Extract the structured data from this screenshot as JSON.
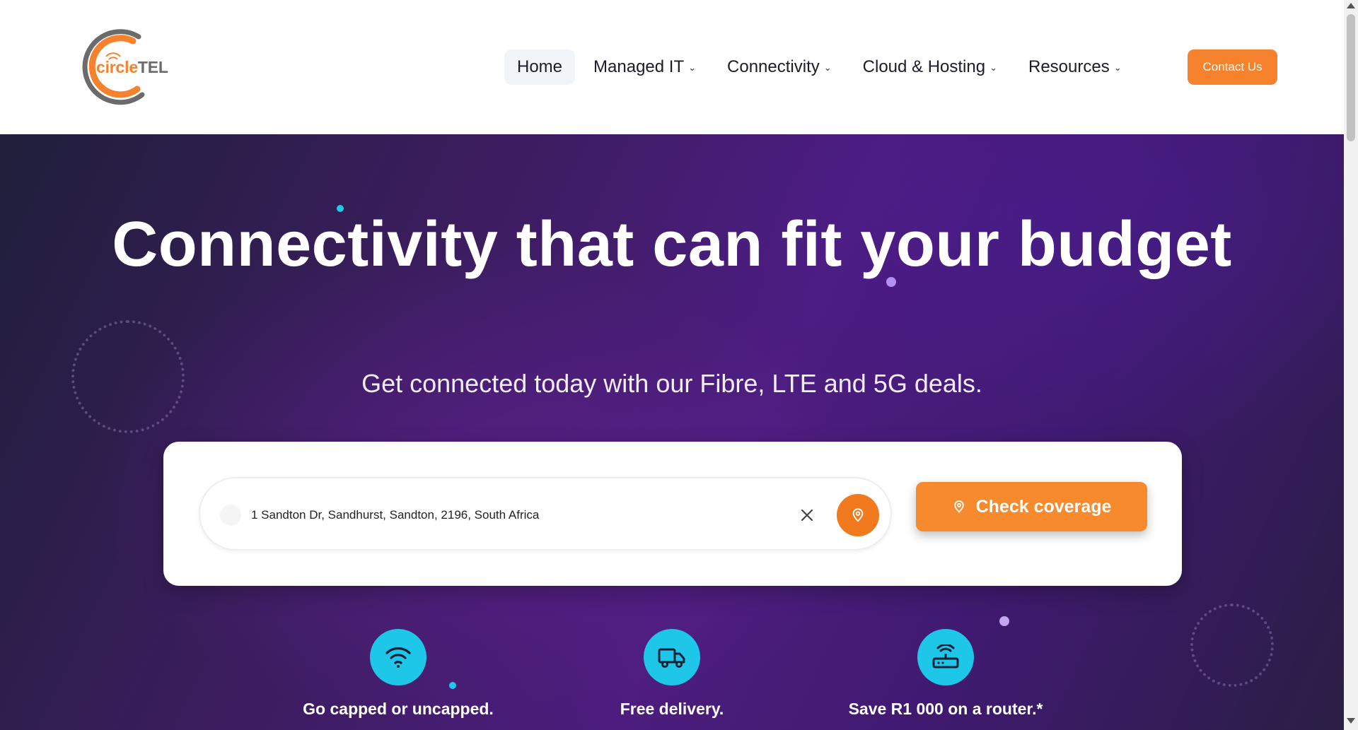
{
  "brand": {
    "logo_text_part1": "circle",
    "logo_text_part2": "TEL",
    "accent_color": "#f7822e",
    "grey_color": "#6b6b6b"
  },
  "nav": {
    "items": [
      {
        "label": "Home",
        "active": true,
        "has_dropdown": false
      },
      {
        "label": "Managed IT",
        "active": false,
        "has_dropdown": true
      },
      {
        "label": "Connectivity",
        "active": false,
        "has_dropdown": true
      },
      {
        "label": "Cloud & Hosting",
        "active": false,
        "has_dropdown": true
      },
      {
        "label": "Resources",
        "active": false,
        "has_dropdown": true
      }
    ],
    "contact_label": "Contact Us"
  },
  "hero": {
    "title": "Connectivity that can fit your budget",
    "subtitle": "Get connected today with our Fibre, LTE and 5G deals."
  },
  "search": {
    "value": "1 Sandton Dr, Sandhurst, Sandton, 2196, South Africa",
    "clear_icon": "close-icon",
    "locate_icon": "map-pin-icon",
    "button_label": "Check coverage",
    "button_icon": "map-pin-icon"
  },
  "features": [
    {
      "label": "Go capped or uncapped.",
      "icon": "wifi-icon"
    },
    {
      "label": "Free delivery.",
      "icon": "truck-icon"
    },
    {
      "label": "Save R1 000 on a router.*",
      "icon": "router-icon"
    }
  ],
  "colors": {
    "hero_purple": "#4c1d7e",
    "feature_cyan": "#1ec6e8",
    "cta_orange": "#f68a2c"
  }
}
